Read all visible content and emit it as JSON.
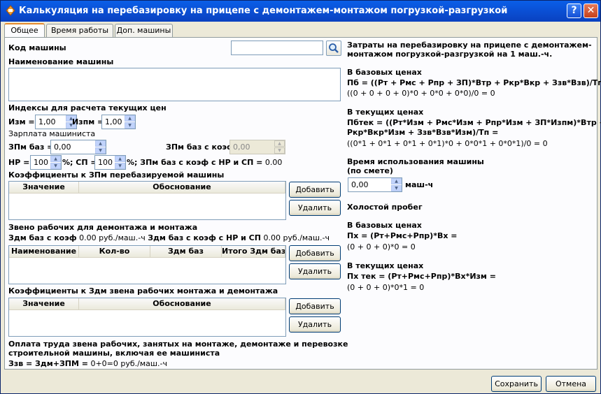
{
  "window": {
    "title": "Калькуляция на перебазировку на прицепе с демонтажем-монтажом погрузкой-разгрузкой",
    "help_label": "?",
    "close_label": "✕"
  },
  "tabs": [
    {
      "label": "Общее",
      "active": true
    },
    {
      "label": "Время работы",
      "active": false
    },
    {
      "label": "Доп. машины",
      "active": false
    }
  ],
  "left": {
    "machine_code_label": "Код машины",
    "machine_code_value": "",
    "machine_name_label": "Наименование машины",
    "machine_name_value": "",
    "indices_label": "Индексы для расчета текущих цен",
    "izm_label": "Изм =",
    "izm_value": "1,00",
    "izpm_label": "Изпм =",
    "izpm_value": "1,00",
    "salary_label": "Зарплата машиниста",
    "zpm_base_label": "ЗПм баз =",
    "zpm_base_value": "0,00",
    "zpm_coef_label": "ЗПм баз с коэф",
    "zpm_coef_value": "0,00",
    "hr_label": "НР =",
    "hr_value": "100",
    "hr_pct": "%; СП =",
    "sp_value": "100",
    "sp_tail_bold": "%; ЗПм баз с коэф с НР и СП =",
    "sp_tail_value": "0.00",
    "coef_zpm_label": "Коэффициенты к ЗПм перебазируемой машины",
    "coef_zpm_columns": [
      "Значение",
      "Обоснование"
    ],
    "crew_label": "Звено рабочих для демонтажа и монтажа",
    "crew_line": {
      "part1_bold": "Здм баз с коэф",
      "part1_value": "0.00 руб./маш.-ч",
      "part2_bold": "Здм баз с коэф с НР и СП",
      "part2_value": "0.00 руб./маш.-ч"
    },
    "crew_columns": [
      "Наименование",
      "Кол-во",
      "Здм баз",
      "Итого Здм баз"
    ],
    "coef_crew_label": "Коэффициенты к Здм звена рабочих монтажа и демонтажа",
    "coef_crew_columns": [
      "Значение",
      "Обоснование"
    ],
    "pay_label_line1": "Оплата труда звена рабочих, занятых на монтаже, демонтаже и перевозке",
    "pay_label_line2": "строительной машины, включая ее машиниста",
    "pay_formula_bold": "Ззв = Здм+ЗПМ =",
    "pay_formula_value": "0+0=0 руб./маш.-ч",
    "add_label": "Добавить",
    "delete_label": "Удалить"
  },
  "right": {
    "header_line1": "Затраты на перебазировку на прицепе с демонтажем-",
    "header_line2": "монтажом погрузкой-разгрузкой на 1 маш.-ч.",
    "base_prices_label": "В базовых ценах",
    "pb_formula": "Пб = ((Рт + Рмс + Рпр + ЗП)*Втр + Ркр*Вкр + Ззв*Взв)/Тп =",
    "pb_value": "((0 + 0 + 0 + 0)*0 + 0*0 + 0*0)/0 = 0",
    "current_prices_label": "В текущих ценах",
    "pbtek_formula1": "Пбтек = ((Рт*Изм + Рмс*Изм + Рпр*Изм + ЗП*Изпм)*Втр +",
    "pbtek_formula2": "Ркр*Вкр*Изм + Ззв*Взв*Изм)/Тп =",
    "pbtek_value": "((0*1 + 0*1 + 0*1 + 0*1)*0 + 0*0*1 + 0*0*1)/0 = 0",
    "usage_label1": "Время использования машины",
    "usage_label2": "(по смете)",
    "usage_value": "0,00",
    "usage_unit": "маш-ч",
    "idle_label": "Холостой пробег",
    "idle_base_label": "В базовых ценах",
    "px_formula": "Пх = (Рт+Рмс+Рпр)*Вх =",
    "px_value": "(0 + 0 + 0)*0 = 0",
    "idle_current_label": "В текущих ценах",
    "pxtek_formula": "Пх тек = (Рт+Рмс+Рпр)*Вх*Изм =",
    "pxtek_value": "(0 + 0 + 0)*0*1 = 0"
  },
  "footer": {
    "save_label": "Сохранить",
    "cancel_label": "Отмена"
  }
}
